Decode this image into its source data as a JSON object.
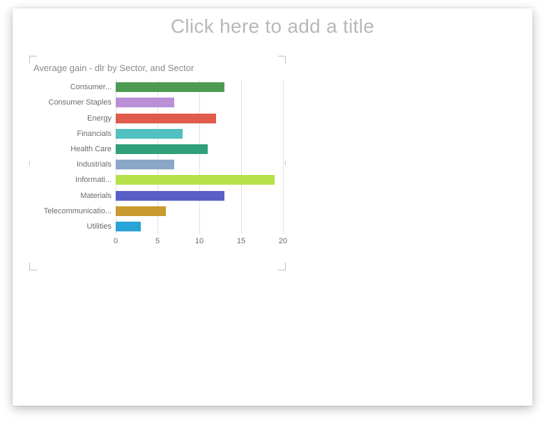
{
  "title_placeholder": "Click here to add a title",
  "chart_data": {
    "type": "bar",
    "orientation": "horizontal",
    "title": "Average gain - dlr by Sector, and Sector",
    "xlabel": "",
    "ylabel": "",
    "xlim": [
      0,
      20
    ],
    "xticks": [
      0,
      5,
      10,
      15,
      20
    ],
    "categories": [
      "Consumer...",
      "Consumer Staples",
      "Energy",
      "Financials",
      "Health Care",
      "Industrials",
      "Informati...",
      "Materials",
      "Telecommunicatio...",
      "Utilities"
    ],
    "values": [
      13,
      7,
      12,
      8,
      11,
      7,
      19,
      13,
      6,
      3
    ],
    "colors": [
      "#4e9a53",
      "#b98fd6",
      "#e05b4b",
      "#52c0c0",
      "#2fa07a",
      "#8aa7c7",
      "#b6e14a",
      "#5a5fc7",
      "#c99a2e",
      "#2aa3d6"
    ]
  }
}
